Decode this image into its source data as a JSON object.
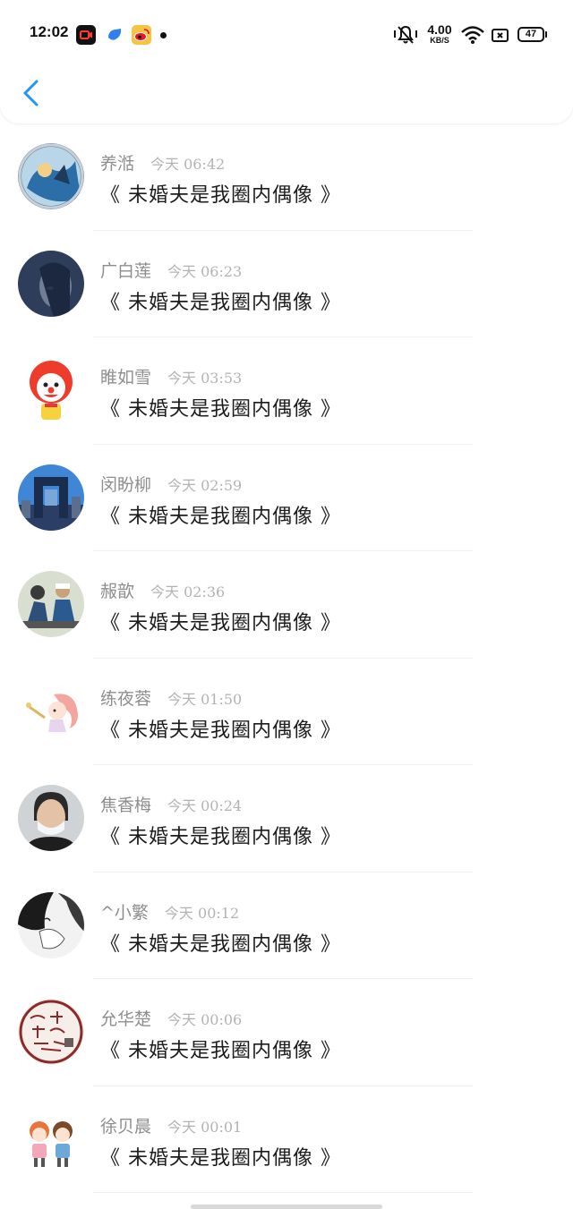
{
  "statusbar": {
    "time": "12:02",
    "speed_value": "4.00",
    "speed_unit": "KB/S",
    "battery": "47"
  },
  "accent_color": "#2196F3",
  "messages": [
    {
      "name": "养湉",
      "time": "今天 06:42",
      "text": "《 未婚夫是我圈内偶像 》"
    },
    {
      "name": "广白莲",
      "time": "今天 06:23",
      "text": "《 未婚夫是我圈内偶像 》"
    },
    {
      "name": "睢如雪",
      "time": "今天 03:53",
      "text": "《 未婚夫是我圈内偶像 》"
    },
    {
      "name": "闵盼柳",
      "time": "今天 02:59",
      "text": "《 未婚夫是我圈内偶像 》"
    },
    {
      "name": "赧歆",
      "time": "今天 02:36",
      "text": "《 未婚夫是我圈内偶像 》"
    },
    {
      "name": "练夜蓉",
      "time": "今天 01:50",
      "text": "《 未婚夫是我圈内偶像 》"
    },
    {
      "name": "焦香梅",
      "time": "今天 00:24",
      "text": "《 未婚夫是我圈内偶像 》"
    },
    {
      "name": "^小繁",
      "time": "今天 00:12",
      "text": "《 未婚夫是我圈内偶像 》"
    },
    {
      "name": "允华楚",
      "time": "今天 00:06",
      "text": "《 未婚夫是我圈内偶像 》"
    },
    {
      "name": "徐贝晨",
      "time": "今天 00:01",
      "text": "《 未婚夫是我圈内偶像 》"
    }
  ]
}
